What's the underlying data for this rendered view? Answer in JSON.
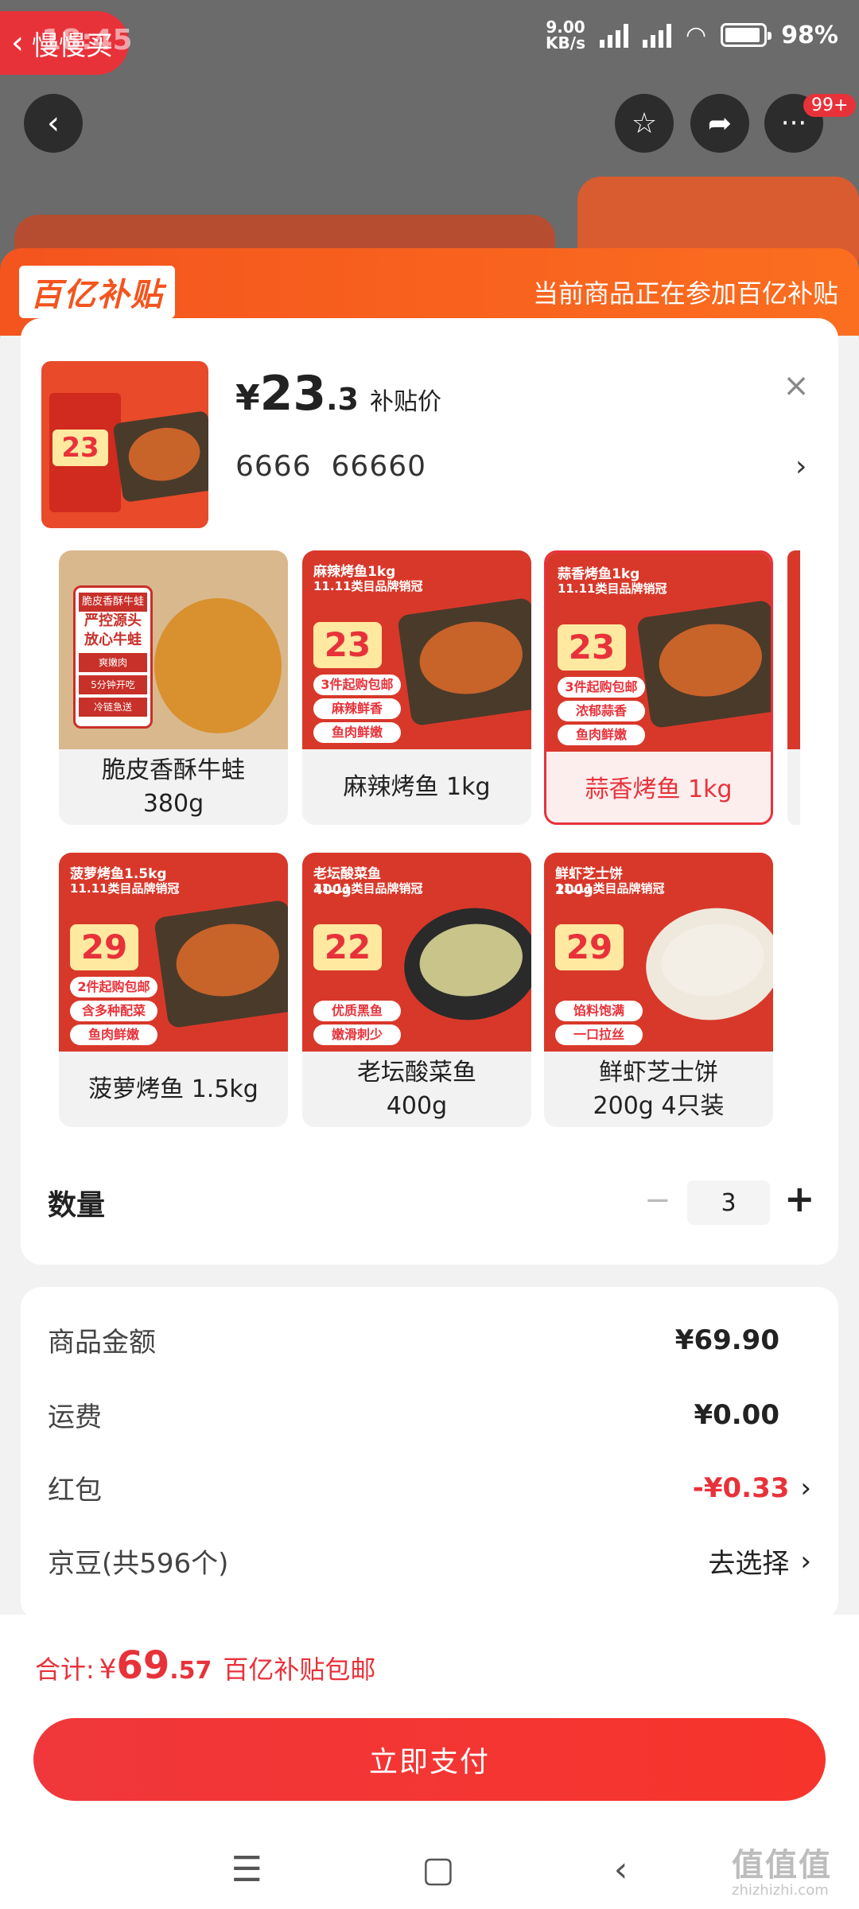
{
  "status_bar": {
    "time": "18:45",
    "back_app": "慢慢买",
    "net_speed": "9.00",
    "net_unit": "KB/s",
    "battery": "98%"
  },
  "top_actions": {
    "badge": "99+"
  },
  "subsidy": {
    "logo": "百亿补贴",
    "notice": "当前商品正在参加百亿补贴"
  },
  "summary": {
    "price_symbol": "¥",
    "price_int": "23",
    "price_dec": ".3",
    "price_tag": "补贴价",
    "selected_spec": "6666  66660"
  },
  "variants": [
    {
      "label": "脆皮香酥牛蛙\n380g",
      "img_text": "脆皮香酥牛蛙",
      "price": "",
      "selected": false
    },
    {
      "label": "麻辣烤鱼 1kg",
      "img_text": "麻辣烤鱼1kg",
      "price": "23",
      "selected": false
    },
    {
      "label": "蒜香烤鱼 1kg",
      "img_text": "蒜香烤鱼1kg",
      "price": "23",
      "selected": true
    },
    {
      "label": "菠萝烤鱼 1.5kg",
      "img_text": "菠萝烤鱼1.5kg",
      "price": "29",
      "selected": false
    },
    {
      "label": "老坛酸菜鱼\n400g",
      "img_text": "老坛酸菜鱼400g",
      "price": "22",
      "selected": false
    },
    {
      "label": "鲜虾芝士饼\n200g 4只装",
      "img_text": "鲜虾芝士饼200g",
      "price": "29",
      "selected": false
    }
  ],
  "variant_labels": {
    "v1": "脆皮香酥牛蛙",
    "v1b": "380g",
    "v2": "麻辣烤鱼 1kg",
    "v3": "蒜香烤鱼 1kg",
    "v4": "菠萝烤鱼 1.5kg",
    "v5": "老坛酸菜鱼",
    "v5b": "400g",
    "v6": "鲜虾芝士饼",
    "v6b": "200g 4只装"
  },
  "variant_img": {
    "v1_title": "脆皮香酥牛蛙",
    "v1_sub": "严控源头",
    "v1_sub2": "放心牛蛙",
    "v1_t1": "爽嫩肉",
    "v1_t2": "5分钟开吃",
    "v1_t3": "冷链急送",
    "v2_title": "麻辣烤鱼1kg",
    "v2_brand": "11.11类目品牌销冠",
    "v2_price": "23",
    "v2_t1": "3件起购包邮",
    "v2_t2": "麻辣鲜香",
    "v2_t3": "鱼肉鲜嫩",
    "v3_title": "蒜香烤鱼1kg",
    "v3_brand": "11.11类目品牌销冠",
    "v3_price": "23",
    "v3_t1": "3件起购包邮",
    "v3_t2": "浓郁蒜香",
    "v3_t3": "鱼肉鲜嫩",
    "v4_title": "菠萝烤鱼1.5kg",
    "v4_brand": "11.11类目品牌销冠",
    "v4_price": "29",
    "v4_t1": "2件起购包邮",
    "v4_t2": "含多种配菜",
    "v4_t3": "鱼肉鲜嫩",
    "v5_title": "老坛酸菜鱼400g",
    "v5_brand": "11.11类目品牌销冠",
    "v5_price": "22",
    "v5_t1": "优质黑鱼",
    "v5_t2": "嫩滑刺少",
    "v6_title": "鲜虾芝士饼200g",
    "v6_brand": "11.11类目品牌销冠",
    "v6_price": "29",
    "v6_t1": "馅料饱满",
    "v6_t2": "一口拉丝"
  },
  "quantity": {
    "label": "数量",
    "minus": "−",
    "value": "3",
    "plus": "+"
  },
  "fees": {
    "goods_label": "商品金额",
    "goods_value": "¥69.90",
    "shipping_label": "运费",
    "shipping_value": "¥0.00",
    "redpacket_label": "红包",
    "redpacket_value": "-¥0.33",
    "jingdou_label": "京豆(共596个)",
    "jingdou_value": "去选择"
  },
  "total": {
    "label": "合计:",
    "symbol": "¥",
    "int": "69",
    "dec": ".57",
    "note": "百亿补贴包邮"
  },
  "pay_button": "立即支付",
  "watermark": {
    "text": "值值值",
    "sub": "zhizhizhi.com"
  },
  "colors": {
    "accent": "#e8323a",
    "subsidy": "#f4541e"
  }
}
